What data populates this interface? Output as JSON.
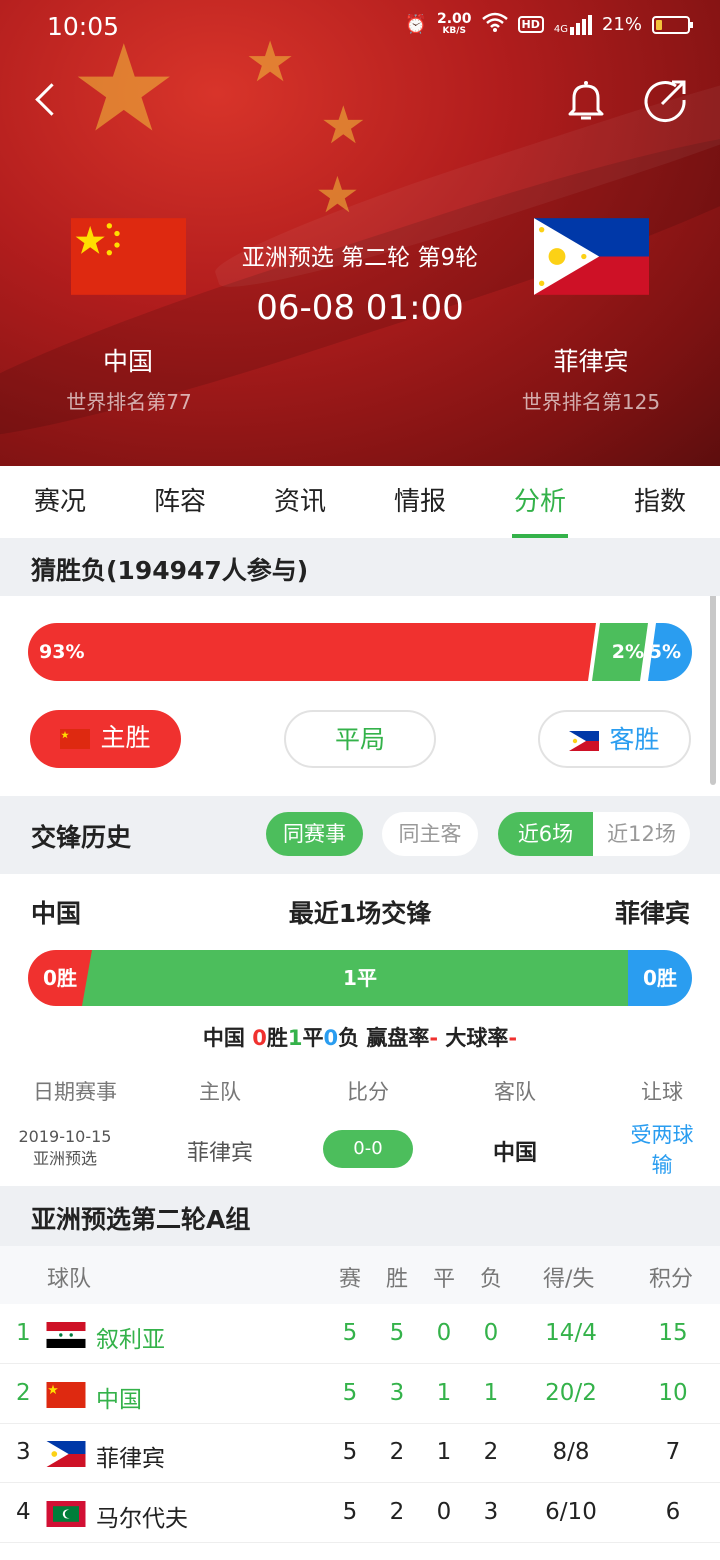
{
  "status_bar": {
    "time": "10:05",
    "net_speed": "2.00",
    "net_unit": "KB/S",
    "hd": "HD",
    "signal": "4G",
    "battery": "21%",
    "battery_level": 0.21
  },
  "match": {
    "round": "亚洲预选 第二轮 第9轮",
    "time": "06-08 01:00",
    "home": {
      "name": "中国",
      "rank": "世界排名第77"
    },
    "away": {
      "name": "菲律宾",
      "rank": "世界排名第125"
    }
  },
  "tabs": [
    "赛况",
    "阵容",
    "资讯",
    "情报",
    "分析",
    "指数"
  ],
  "active_tab": "分析",
  "guess": {
    "title": "猜胜负(194947人参与)",
    "home_pct": "93%",
    "draw_pct": "2%",
    "away_pct": "5%",
    "home_value": 93,
    "draw_value": 2,
    "away_value": 5,
    "home_btn": "主胜",
    "draw_btn": "平局",
    "away_btn": "客胜"
  },
  "h2h": {
    "title": "交锋历史",
    "filter_same_event": "同赛事",
    "filter_same_home": "同主客",
    "range_6": "近6场",
    "range_12": "近12场",
    "home_team": "中国",
    "summary_title": "最近1场交锋",
    "away_team": "菲律宾",
    "home_wins": "0胜",
    "draws": "1平",
    "away_wins": "0胜",
    "stats": {
      "team": "中国",
      "win_num": "0",
      "win_label": "胜",
      "draw_num": "1",
      "draw_label": "平",
      "loss_num": "0",
      "loss_label": "负",
      "win_rate_label": "赢盘率",
      "win_rate": "-",
      "over_label": "大球率",
      "over_rate": "-"
    },
    "columns": [
      "日期赛事",
      "主队",
      "比分",
      "客队",
      "让球"
    ],
    "rows": [
      {
        "date": "2019-10-15",
        "event": "亚洲预选",
        "home": "菲律宾",
        "score": "0-0",
        "away": "中国",
        "handicap_line1": "受两球",
        "handicap_line2": "输"
      }
    ]
  },
  "standings": {
    "title": "亚洲预选第二轮A组",
    "columns": {
      "team": "球队",
      "played": "赛",
      "won": "胜",
      "drawn": "平",
      "lost": "负",
      "goals": "得/失",
      "points": "积分"
    },
    "rows": [
      {
        "pos": "1",
        "team": "叙利亚",
        "played": "5",
        "won": "5",
        "drawn": "0",
        "lost": "0",
        "goals": "14/4",
        "points": "15",
        "highlight": true
      },
      {
        "pos": "2",
        "team": "中国",
        "played": "5",
        "won": "3",
        "drawn": "1",
        "lost": "1",
        "goals": "20/2",
        "points": "10",
        "highlight": true
      },
      {
        "pos": "3",
        "team": "菲律宾",
        "played": "5",
        "won": "2",
        "drawn": "1",
        "lost": "2",
        "goals": "8/8",
        "points": "7",
        "highlight": false
      },
      {
        "pos": "4",
        "team": "马尔代夫",
        "played": "5",
        "won": "2",
        "drawn": "0",
        "lost": "3",
        "goals": "6/10",
        "points": "6",
        "highlight": false
      }
    ]
  },
  "colors": {
    "accent_green": "#34b24a",
    "home_red": "#f0312f",
    "draw_green": "#4cbe5c",
    "away_blue": "#2a9df0"
  }
}
